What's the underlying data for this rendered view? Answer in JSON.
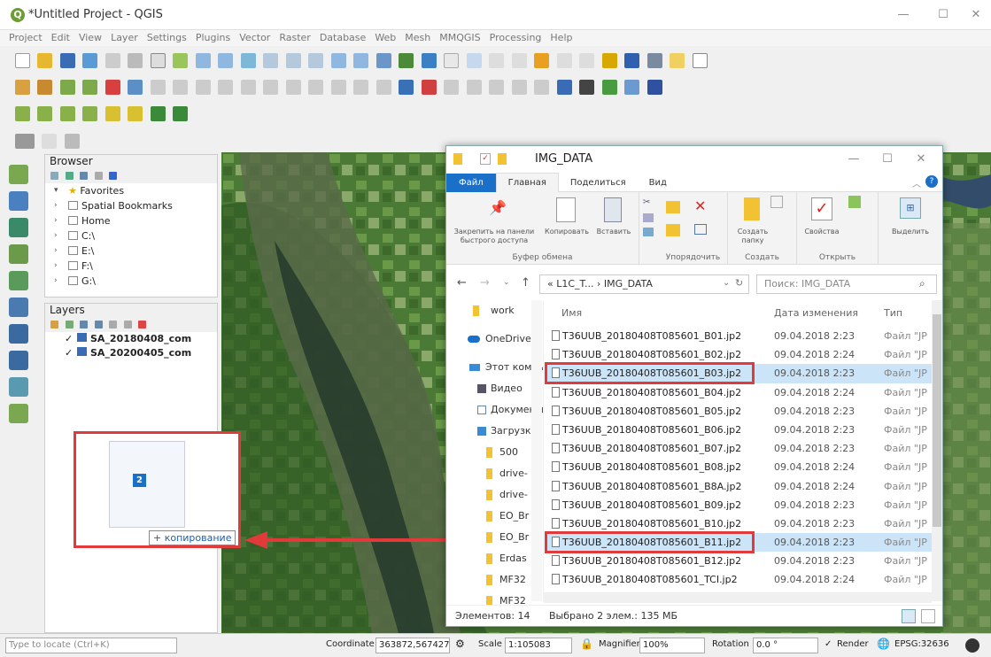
{
  "window": {
    "title": "*Untitled Project - QGIS",
    "minimize": "—",
    "maximize": "☐",
    "close": "✕"
  },
  "menu": [
    "Project",
    "Edit",
    "View",
    "Layer",
    "Settings",
    "Plugins",
    "Vector",
    "Raster",
    "Database",
    "Web",
    "Mesh",
    "MMQGIS",
    "Processing",
    "Help"
  ],
  "browser": {
    "title": "Browser",
    "items": [
      {
        "label": "Favorites",
        "expanded": true
      },
      {
        "label": "Spatial Bookmarks"
      },
      {
        "label": "Home"
      },
      {
        "label": "C:\\"
      },
      {
        "label": "E:\\"
      },
      {
        "label": "F:\\"
      },
      {
        "label": "G:\\"
      }
    ]
  },
  "layers": {
    "title": "Layers",
    "items": [
      {
        "label": "SA_20180408_com",
        "checked": "✓"
      },
      {
        "label": "SA_20200405_com",
        "checked": "✓"
      }
    ]
  },
  "drag": {
    "badge": "2",
    "label": "+ копирование"
  },
  "explorer": {
    "title": "IMG_DATA",
    "minimize": "—",
    "maximize": "☐",
    "close": "✕",
    "tabs": {
      "file": "Файл",
      "home": "Главная",
      "share": "Поделиться",
      "view": "Вид"
    },
    "ribbon": {
      "pin": "Закрепить на панели быстрого доступа",
      "copy": "Копировать",
      "paste": "Вставить",
      "clipboard_group": "Буфер обмена",
      "organize_group": "Упорядочить",
      "new_folder": "Создать папку",
      "create_group": "Создать",
      "properties": "Свойства",
      "open_group": "Открыть",
      "select": "Выделить"
    },
    "address": {
      "path": "« L1C_T... › IMG_DATA",
      "search_placeholder": "Поиск: IMG_DATA"
    },
    "nav": [
      {
        "label": "work",
        "type": "folder"
      },
      {
        "label": "OneDrive",
        "type": "cloud"
      },
      {
        "label": "Этот компьютер",
        "type": "pc"
      },
      {
        "label": "Видео",
        "type": "sub"
      },
      {
        "label": "Документы",
        "type": "sub"
      },
      {
        "label": "Загрузки",
        "type": "sub"
      },
      {
        "label": "500",
        "type": "folder"
      },
      {
        "label": "drive-",
        "type": "folder"
      },
      {
        "label": "drive-",
        "type": "folder"
      },
      {
        "label": "EO_Br",
        "type": "folder"
      },
      {
        "label": "EO_Br",
        "type": "folder"
      },
      {
        "label": "Erdas",
        "type": "folder"
      },
      {
        "label": "MF32",
        "type": "folder"
      },
      {
        "label": "MF32",
        "type": "folder"
      }
    ],
    "columns": {
      "name": "Имя",
      "date": "Дата изменения",
      "type": "Тип"
    },
    "files": [
      {
        "name": "T36UUB_20180408T085601_B01.jp2",
        "date": "09.04.2018 2:23",
        "type": "Файл \"JP",
        "selected": false
      },
      {
        "name": "T36UUB_20180408T085601_B02.jp2",
        "date": "09.04.2018 2:24",
        "type": "Файл \"JP",
        "selected": false
      },
      {
        "name": "T36UUB_20180408T085601_B03.jp2",
        "date": "09.04.2018 2:23",
        "type": "Файл \"JP",
        "selected": true
      },
      {
        "name": "T36UUB_20180408T085601_B04.jp2",
        "date": "09.04.2018 2:24",
        "type": "Файл \"JP",
        "selected": false
      },
      {
        "name": "T36UUB_20180408T085601_B05.jp2",
        "date": "09.04.2018 2:23",
        "type": "Файл \"JP",
        "selected": false
      },
      {
        "name": "T36UUB_20180408T085601_B06.jp2",
        "date": "09.04.2018 2:23",
        "type": "Файл \"JP",
        "selected": false
      },
      {
        "name": "T36UUB_20180408T085601_B07.jp2",
        "date": "09.04.2018 2:23",
        "type": "Файл \"JP",
        "selected": false
      },
      {
        "name": "T36UUB_20180408T085601_B08.jp2",
        "date": "09.04.2018 2:24",
        "type": "Файл \"JP",
        "selected": false
      },
      {
        "name": "T36UUB_20180408T085601_B8A.jp2",
        "date": "09.04.2018 2:24",
        "type": "Файл \"JP",
        "selected": false
      },
      {
        "name": "T36UUB_20180408T085601_B09.jp2",
        "date": "09.04.2018 2:23",
        "type": "Файл \"JP",
        "selected": false
      },
      {
        "name": "T36UUB_20180408T085601_B10.jp2",
        "date": "09.04.2018 2:23",
        "type": "Файл \"JP",
        "selected": false
      },
      {
        "name": "T36UUB_20180408T085601_B11.jp2",
        "date": "09.04.2018 2:23",
        "type": "Файл \"JP",
        "selected": true
      },
      {
        "name": "T36UUB_20180408T085601_B12.jp2",
        "date": "09.04.2018 2:23",
        "type": "Файл \"JP",
        "selected": false
      },
      {
        "name": "T36UUB_20180408T085601_TCI.jp2",
        "date": "09.04.2018 2:24",
        "type": "Файл \"JP",
        "selected": false
      }
    ],
    "status": {
      "count": "Элементов: 14",
      "selected": "Выбрано 2 элем.: 135 МБ"
    }
  },
  "statusbar": {
    "locate_placeholder": "Type to locate (Ctrl+K)",
    "coordinate_label": "Coordinate",
    "coordinate_value": "363872,5674278",
    "scale_label": "Scale",
    "scale_value": "1:105083",
    "magnifier_label": "Magnifier",
    "magnifier_value": "100%",
    "rotation_label": "Rotation",
    "rotation_value": "0.0 °",
    "render_check": "✓",
    "render_label": "Render",
    "crs": "EPSG:32636"
  }
}
